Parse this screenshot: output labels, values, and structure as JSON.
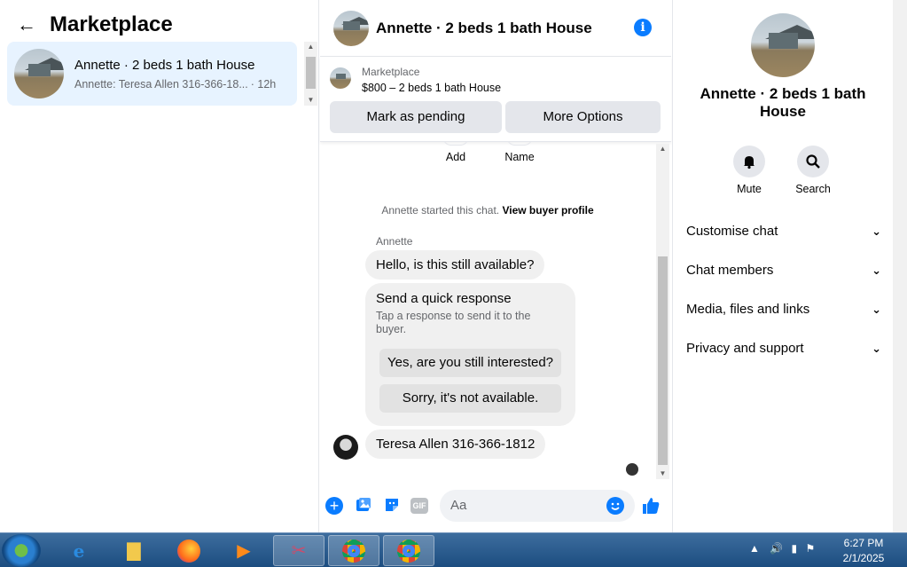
{
  "left": {
    "title": "Marketplace",
    "conversation": {
      "name": "Annette · 2 beds 1 bath House",
      "snippet": "Annette: Teresa Allen 316-366-18...",
      "time": "· 12h"
    }
  },
  "chat_header": {
    "title": "Annette · 2 beds 1 bath House",
    "info_icon": "info-icon"
  },
  "listing": {
    "source": "Marketplace",
    "price_title": "$800 – 2 beds 1 bath House",
    "mark_pending": "Mark as pending",
    "more_options": "More Options"
  },
  "chat": {
    "actions": [
      "Add",
      "Name"
    ],
    "started_text": "Annette started this chat.",
    "view_profile": "View buyer profile",
    "sender": "Annette",
    "message1": "Hello, is this still available?",
    "quick_response": {
      "title": "Send a quick response",
      "subtitle": "Tap a response to send it to the buyer.",
      "options": [
        "Yes, are you still interested?",
        "Sorry, it's not available."
      ]
    },
    "message2": "Teresa Allen 316-366-1812"
  },
  "composer": {
    "placeholder": "Aa",
    "icons": [
      "plus-icon",
      "photo-icon",
      "sticker-icon",
      "gif-icon",
      "emoji-icon",
      "thumbs-up-icon"
    ],
    "gif_label": "GIF"
  },
  "details": {
    "title": "Annette · 2 beds 1 bath House",
    "mute": "Mute",
    "search": "Search",
    "sections": [
      "Customise chat",
      "Chat members",
      "Media, files and links",
      "Privacy and support"
    ]
  },
  "taskbar": {
    "time": "6:27 PM",
    "date": "2/1/2025"
  },
  "colors": {
    "accent": "#0a7cff",
    "selected_bg": "#e7f3ff",
    "bubble": "#f0f0f0",
    "button_bg": "#e4e6eb"
  }
}
